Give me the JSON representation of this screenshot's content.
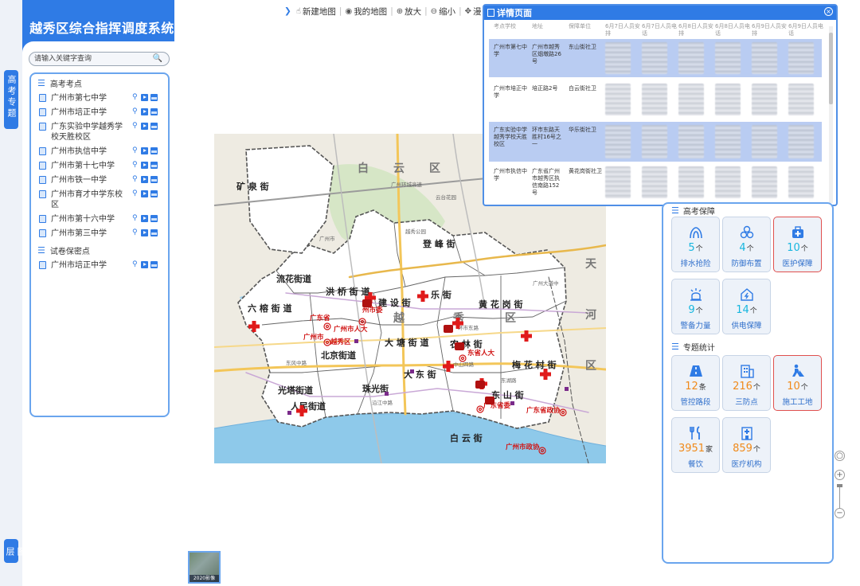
{
  "app": {
    "title": "越秀区综合指挥调度系统",
    "side_tab": "高考专题",
    "side_tab_small": "图层"
  },
  "search": {
    "placeholder": "请输入关键字查询"
  },
  "tree": {
    "groups": [
      {
        "label": "高考考点",
        "items": [
          "广州市第七中学",
          "广州市培正中学",
          "广东实验中学越秀学校天胜校区",
          "广州市执信中学",
          "广州市第十七中学",
          "广州市铁一中学",
          "广州市育才中学东校区",
          "广州市第十六中学",
          "广州市第三中学"
        ]
      },
      {
        "label": "试卷保密点",
        "items": [
          "广州市培正中学"
        ]
      }
    ]
  },
  "toolbar": {
    "items": [
      {
        "icon": "hand-icon",
        "label": "新建地图"
      },
      {
        "icon": "eye-icon",
        "label": "我的地图"
      },
      {
        "icon": "zoom-in-icon",
        "label": "放大"
      },
      {
        "icon": "zoom-out-icon",
        "label": "缩小"
      },
      {
        "icon": "pan-icon",
        "label": "漫"
      }
    ]
  },
  "map": {
    "districts": {
      "baiyun": "白 云 区",
      "yuexiu": "越 秀 区",
      "tianhe": "天 河 区"
    },
    "streets": [
      "矿泉街",
      "登峰街",
      "流花街道",
      "洪桥街道",
      "建设街",
      "六榕街道",
      "黄花岗街",
      "农林街",
      "大塘街道",
      "北京街道",
      "梅花村街",
      "大东街",
      "光塔街道",
      "珠光街",
      "东山街",
      "人民街道",
      "白云街"
    ],
    "red_labels": [
      "广州市委",
      "广东省",
      "广州市人大",
      "广州市",
      "越秀区",
      "东省人大",
      "广东省委",
      "广东省政协",
      "广州市政协"
    ],
    "road_labels": [
      "广州环城高速",
      "白云花园",
      "云台花园",
      "广州大道中",
      "环市东路",
      "东风中路",
      "中山四路",
      "东湖路",
      "沿江中路",
      "广州市",
      "越秀公园"
    ]
  },
  "thumbnail": {
    "caption": "2020影像"
  },
  "popup": {
    "title": "详情页面",
    "close": "×",
    "headers": [
      "考点学校",
      "地址",
      "保障单位",
      "6月7日人员安排",
      "6月7日人员电话",
      "6月8日人员安排",
      "6月8日人员电话",
      "6月9日人员安排",
      "6月9日人员电话"
    ],
    "rows": [
      {
        "school": "广州市第七中学",
        "address": "广州市越秀区烟墩路26号",
        "unit": "东山街社卫",
        "selected": true
      },
      {
        "school": "广州市培正中学",
        "address": "培正路2号",
        "unit": "白云街社卫",
        "selected": false
      },
      {
        "school": "广东实验中学越秀学校天胜校区",
        "address": "环市东路天胜村16号之一",
        "unit": "华乐街社卫",
        "selected": true
      },
      {
        "school": "广州市执信中学",
        "address": "广东省广州市越秀区执信南路152号",
        "unit": "黄花岗街社卫",
        "selected": false
      }
    ]
  },
  "guarantee": {
    "title": "高考保障",
    "cards": [
      {
        "icon": "drainage-icon",
        "value": "5",
        "unit": "个",
        "label": "排水抢险",
        "color": "cyan",
        "highlight": false
      },
      {
        "icon": "defense-icon",
        "value": "4",
        "unit": "个",
        "label": "防御布置",
        "color": "cyan",
        "highlight": false
      },
      {
        "icon": "medical-kit-icon",
        "value": "10",
        "unit": "个",
        "label": "医护保障",
        "color": "cyan",
        "highlight": true
      },
      {
        "icon": "police-icon",
        "value": "9",
        "unit": "个",
        "label": "警备力量",
        "color": "cyan",
        "highlight": false
      },
      {
        "icon": "power-supply-icon",
        "value": "14",
        "unit": "个",
        "label": "供电保障",
        "color": "cyan",
        "highlight": false
      }
    ]
  },
  "stats": {
    "title": "专题统计",
    "cards": [
      {
        "icon": "road-icon",
        "value": "12",
        "unit": "条",
        "label": "管控路段",
        "color": "orange",
        "highlight": false
      },
      {
        "icon": "building-icon",
        "value": "216",
        "unit": "个",
        "label": "三防点",
        "color": "orange",
        "highlight": false
      },
      {
        "icon": "construction-icon",
        "value": "10",
        "unit": "个",
        "label": "施工工地",
        "color": "orange",
        "highlight": true
      },
      {
        "icon": "dining-icon",
        "value": "3951",
        "unit": "家",
        "label": "餐饮",
        "color": "orange",
        "highlight": false
      },
      {
        "icon": "hospital-icon",
        "value": "859",
        "unit": "个",
        "label": "医疗机构",
        "color": "orange",
        "highlight": false
      }
    ]
  },
  "colors": {
    "primary": "#2f7be5",
    "cyan": "#16b6df",
    "orange": "#f08a1a",
    "alert": "#e0504e",
    "marker_red": "#d01515"
  }
}
